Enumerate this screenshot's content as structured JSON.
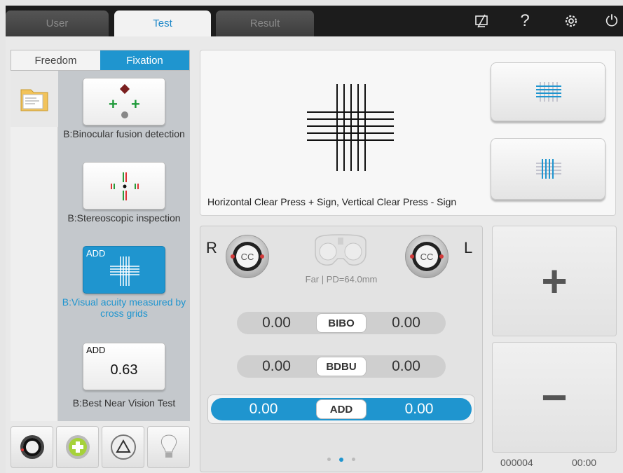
{
  "tabs": [
    {
      "label": "User",
      "active": false
    },
    {
      "label": "Test",
      "active": true
    },
    {
      "label": "Result",
      "active": false
    }
  ],
  "top_icons": [
    "screen-toggle-icon",
    "help-icon",
    "settings-icon",
    "power-icon"
  ],
  "top_icon_glyphs": {
    "help": "?",
    "power": "⏻"
  },
  "mode_switch": {
    "freedom": "Freedom",
    "fixation": "Fixation",
    "selected": "Fixation"
  },
  "tests": [
    {
      "label": "B:Binocular fusion detection",
      "active": false
    },
    {
      "label": "B:Stereoscopic inspection",
      "active": false
    },
    {
      "label": "B:Visual acuity measured by cross grids",
      "active": true,
      "badge": "ADD"
    },
    {
      "label": "B:Best Near Vision Test",
      "active": false,
      "badge": "ADD",
      "value": "0.63"
    }
  ],
  "chart": {
    "instruction": "Horizontal Clear Press + Sign, Vertical Clear Press - Sign"
  },
  "controls": {
    "right_eye": "R",
    "left_eye": "L",
    "right_lens": "CC",
    "left_lens": "CC",
    "pd_info": "Far | PD=64.0mm",
    "rows": [
      {
        "tag": "BIBO",
        "right": "0.00",
        "left": "0.00",
        "active": false
      },
      {
        "tag": "BDBU",
        "right": "0.00",
        "left": "0.00",
        "active": false
      },
      {
        "tag": "ADD",
        "right": "0.00",
        "left": "0.00",
        "active": true
      }
    ],
    "pages": 3,
    "current_page": 2
  },
  "adjust": {
    "plus": "+",
    "minus": "−"
  },
  "footer": {
    "record_id": "000004",
    "time": "00:00"
  },
  "colors": {
    "accent": "#1f95cf",
    "topbar": "#1c1c1c",
    "lens_dot": "#d23a3a"
  }
}
